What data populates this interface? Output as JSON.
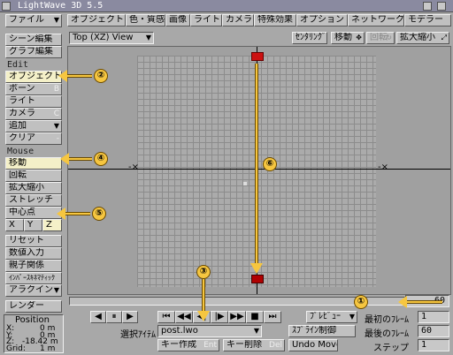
{
  "window": {
    "title": "LightWave 3D 5.5"
  },
  "menubar": {
    "file_label": "ファイル",
    "tabs": [
      "オブジェクト",
      "色・質感",
      "画像",
      "ライト",
      "カメラ",
      "特殊効果",
      "オプション",
      "ネットワーク",
      "モデラー"
    ]
  },
  "viewbar": {
    "view_select": "Top (XZ) View",
    "centering": "ｾﾝﾀﾘﾝｸﾞ",
    "move": "移動",
    "rotate": "回転",
    "scale": "拡大縮小"
  },
  "sidebar": {
    "scene_edit": "シーン編集",
    "graph_edit": "グラフ編集",
    "edit_label": "Edit",
    "edit_items": [
      {
        "label": "オブジェクト",
        "key": ""
      },
      {
        "label": "ボーン",
        "key": "B"
      },
      {
        "label": "ライト",
        "key": ""
      },
      {
        "label": "カメラ",
        "key": "C"
      },
      {
        "label": "追加",
        "key": ""
      },
      {
        "label": "クリア",
        "key": "-"
      }
    ],
    "mouse_label": "Mouse",
    "mouse_items": [
      {
        "label": "移動",
        "key": ""
      },
      {
        "label": "回転",
        "key": ""
      },
      {
        "label": "拡大縮小",
        "key": ""
      },
      {
        "label": "ストレッチ",
        "key": ""
      },
      {
        "label": "中心点",
        "key": ""
      }
    ],
    "axes": [
      "X",
      "Y",
      "Z"
    ],
    "reset": "リセット",
    "numeric": "数値入力",
    "parent": "親子関係",
    "ik": "ｲﾝﾊﾞｰｽｷﾈﾏﾃｨｯｸ",
    "align": "アラクイン",
    "render": "レンダー"
  },
  "position": {
    "label": "Position",
    "x_label": "X:",
    "x_value": "0 m",
    "y_label": "Y:",
    "y_value": "0 m",
    "z_label": "Z:",
    "z_value": "-18.42 m",
    "grid_label": "Grid:",
    "grid_value": "1 m"
  },
  "timeline": {
    "frame_value": "60",
    "selected_item_label": "選択ｱｲﾃﾑ",
    "selected_item": "post.lwo",
    "preview": "ﾌﾟﾚﾋﾞｭｰ",
    "spline": "ｽﾌﾟﾗｲﾝ制御",
    "create_key": "キー作成",
    "create_key_shortcut": "Ent",
    "delete_key": "キー削除",
    "delete_key_shortcut": "Del",
    "undo_move": "Undo Move",
    "first_frame_label": "最初のﾌﾚｰﾑ",
    "first_frame": "1",
    "last_frame_label": "最後のﾌﾚｰﾑ",
    "last_frame": "60",
    "step_label": "ステップ",
    "step": "1"
  },
  "annotations": [
    "①",
    "②",
    "③",
    "④",
    "⑤",
    "⑥"
  ],
  "colors": {
    "callout": "#f6c640",
    "object": "#cc1111",
    "panel": "#c0c0c0"
  }
}
